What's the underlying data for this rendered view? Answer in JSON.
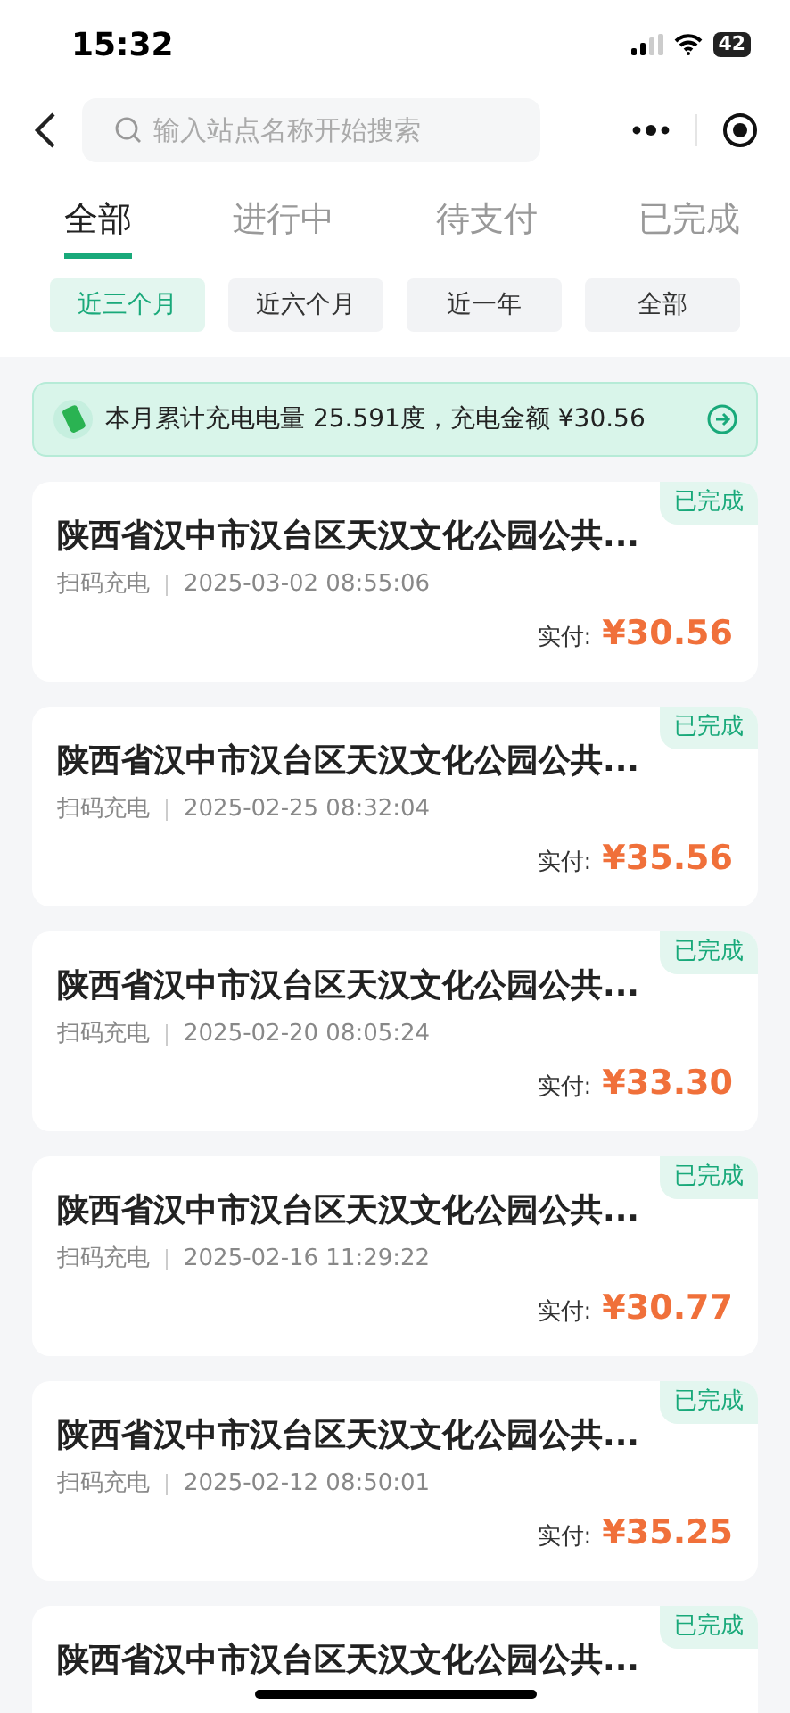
{
  "status_bar": {
    "time": "15:32",
    "battery": "42"
  },
  "search": {
    "placeholder": "输入站点名称开始搜索"
  },
  "tabs": [
    {
      "label": "全部",
      "selected": true
    },
    {
      "label": "进行中",
      "selected": false
    },
    {
      "label": "待支付",
      "selected": false
    },
    {
      "label": "已完成",
      "selected": false
    }
  ],
  "filters": [
    {
      "label": "近三个月",
      "selected": true
    },
    {
      "label": "近六个月",
      "selected": false
    },
    {
      "label": "近一年",
      "selected": false
    },
    {
      "label": "全部",
      "selected": false
    }
  ],
  "summary": "本月累计充电电量 25.591度，充电金额 ¥30.56",
  "orders": [
    {
      "station": "陕西省汉中市汉台区天汉文化公园公共...",
      "status": "已完成",
      "type": "扫码充电",
      "time": "2025-03-02 08:55:06",
      "paid_label": "实付:",
      "amount": "¥30.56"
    },
    {
      "station": "陕西省汉中市汉台区天汉文化公园公共...",
      "status": "已完成",
      "type": "扫码充电",
      "time": "2025-02-25 08:32:04",
      "paid_label": "实付:",
      "amount": "¥35.56"
    },
    {
      "station": "陕西省汉中市汉台区天汉文化公园公共...",
      "status": "已完成",
      "type": "扫码充电",
      "time": "2025-02-20 08:05:24",
      "paid_label": "实付:",
      "amount": "¥33.30"
    },
    {
      "station": "陕西省汉中市汉台区天汉文化公园公共...",
      "status": "已完成",
      "type": "扫码充电",
      "time": "2025-02-16 11:29:22",
      "paid_label": "实付:",
      "amount": "¥30.77"
    },
    {
      "station": "陕西省汉中市汉台区天汉文化公园公共...",
      "status": "已完成",
      "type": "扫码充电",
      "time": "2025-02-12 08:50:01",
      "paid_label": "实付:",
      "amount": "¥35.25"
    },
    {
      "station": "陕西省汉中市汉台区天汉文化公园公共...",
      "status": "已完成"
    }
  ]
}
